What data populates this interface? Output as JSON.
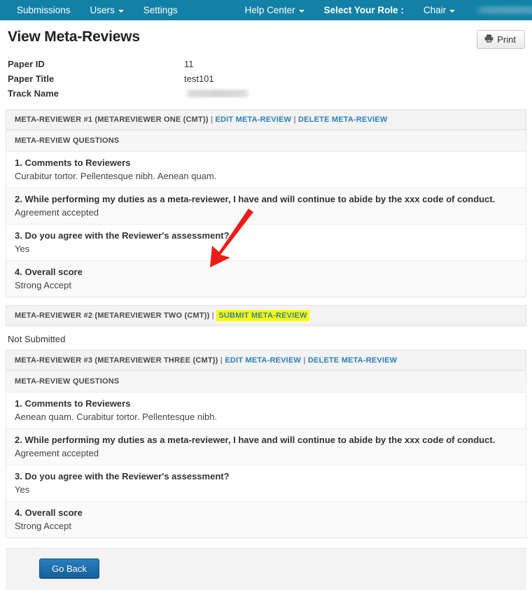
{
  "navbar": {
    "background": "#1380a6",
    "left_items": [
      {
        "label": "Submissions",
        "has_caret": false
      },
      {
        "label": "Users",
        "has_caret": true
      },
      {
        "label": "Settings",
        "has_caret": false
      }
    ],
    "right_items": [
      {
        "label": "Help Center",
        "has_caret": true,
        "bold": false
      },
      {
        "label": "Select Your Role :",
        "has_caret": false,
        "bold": true
      },
      {
        "label": "Chair",
        "has_caret": true,
        "bold": false
      }
    ],
    "redacted_items": 2
  },
  "header": {
    "title": "View Meta-Reviews",
    "print_label": "Print",
    "print_icon": "printer-icon"
  },
  "paper_info": [
    {
      "label": "Paper ID",
      "value": "11",
      "redacted": false
    },
    {
      "label": "Paper Title",
      "value": "test101",
      "redacted": false
    },
    {
      "label": "Track Name",
      "value": "",
      "redacted": true
    }
  ],
  "questions_header": "META-REVIEW QUESTIONS",
  "not_submitted_text": "Not Submitted",
  "reviewers": [
    {
      "heading": "META-REVIEWER #1 (METAREVIEWER ONE (CMT))",
      "separator": "|",
      "links": [
        {
          "label": "EDIT META-REVIEW",
          "highlight": false
        },
        {
          "label": "DELETE META-REVIEW",
          "highlight": false
        }
      ],
      "submitted": true,
      "qa": [
        {
          "question": "1. Comments to Reviewers",
          "answer": "Curabitur tortor. Pellentesque nibh. Aenean quam."
        },
        {
          "question": "2. While performing my duties as a meta-reviewer, I have and will continue to abide by the xxx code of conduct.",
          "answer": "Agreement accepted"
        },
        {
          "question": "3. Do you agree with the Reviewer's assessment?",
          "answer": "Yes"
        },
        {
          "question": "4. Overall score",
          "answer": "Strong Accept"
        }
      ]
    },
    {
      "heading": "META-REVIEWER #2 (METAREVIEWER TWO (CMT))",
      "separator": "|",
      "links": [
        {
          "label": "SUBMIT META-REVIEW",
          "highlight": true
        }
      ],
      "submitted": false,
      "qa": []
    },
    {
      "heading": "META-REVIEWER #3 (METAREVIEWER THREE (CMT))",
      "separator": "|",
      "links": [
        {
          "label": "EDIT META-REVIEW",
          "highlight": false
        },
        {
          "label": "DELETE META-REVIEW",
          "highlight": false
        }
      ],
      "submitted": true,
      "qa": [
        {
          "question": "1. Comments to Reviewers",
          "answer": "Aenean quam. Curabitur tortor. Pellentesque nibh."
        },
        {
          "question": "2. While performing my duties as a meta-reviewer, I have and will continue to abide by the xxx code of conduct.",
          "answer": "Agreement accepted"
        },
        {
          "question": "3. Do you agree with the Reviewer's assessment?",
          "answer": "Yes"
        },
        {
          "question": "4. Overall score",
          "answer": "Strong Accept"
        }
      ]
    }
  ],
  "footer": {
    "go_back_label": "Go Back"
  },
  "annotation": {
    "type": "arrow",
    "color": "#ee1c17",
    "points_to": "SUBMIT META-REVIEW"
  }
}
